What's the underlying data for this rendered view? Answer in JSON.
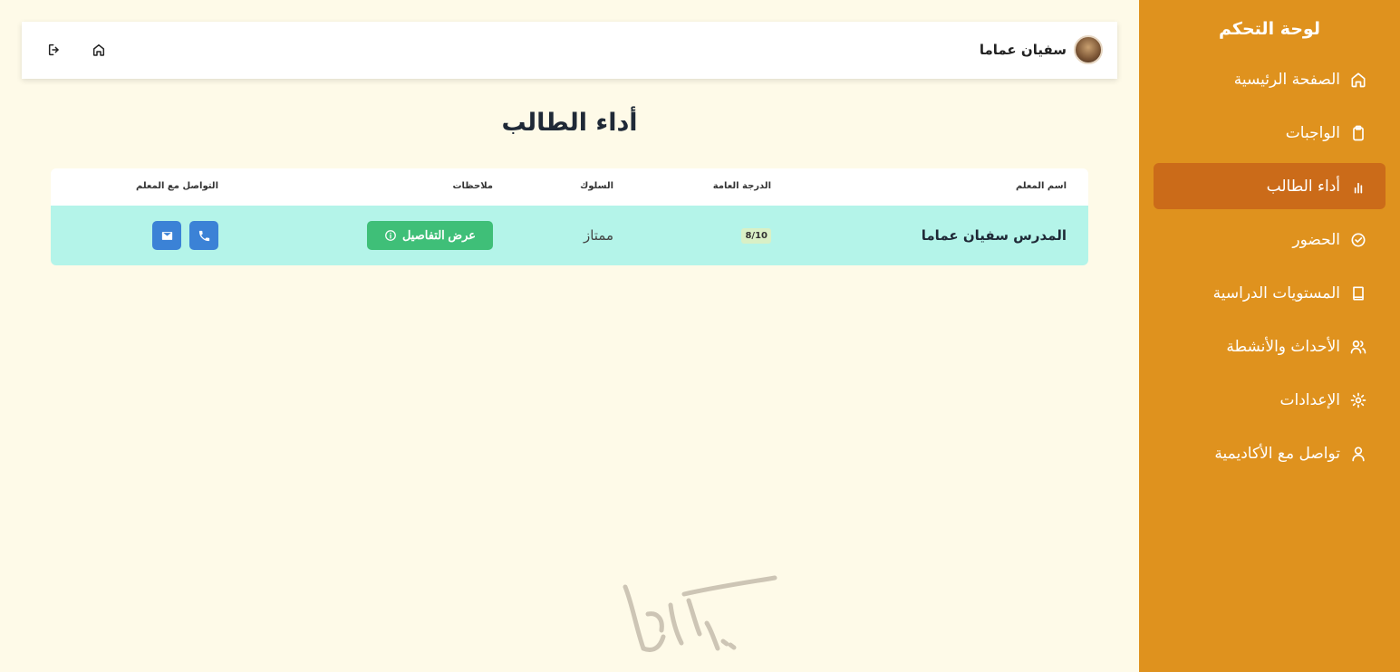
{
  "sidebar": {
    "title": "لوحة التحكم",
    "items": [
      {
        "label": "الصفحة الرئيسية",
        "icon": "home-icon"
      },
      {
        "label": "الواجبات",
        "icon": "clipboard-icon"
      },
      {
        "label": "أداء الطالب",
        "icon": "bar-chart-icon",
        "active": true
      },
      {
        "label": "الحضور",
        "icon": "check-circle-icon"
      },
      {
        "label": "المستويات الدراسية",
        "icon": "book-icon"
      },
      {
        "label": "الأحداث والأنشطة",
        "icon": "users-icon"
      },
      {
        "label": "الإعدادات",
        "icon": "gear-icon"
      },
      {
        "label": "تواصل مع الأكاديمية",
        "icon": "user-icon"
      }
    ]
  },
  "header": {
    "user_name": "سفيان عماما"
  },
  "main": {
    "title": "أداء الطالب",
    "table": {
      "columns": [
        "اسم المعلم",
        "الدرجة العامة",
        "السلوك",
        "ملاحظات",
        "التواصل مع المعلم"
      ],
      "rows": [
        {
          "teacher": "المدرس سفيان عماما",
          "grade": "8/10",
          "behavior": "ممتاز",
          "notes_button": "عرض التفاصيل"
        }
      ]
    }
  },
  "colors": {
    "sidebar_bg": "#df921e",
    "sidebar_active": "#cb6b19",
    "page_bg": "#fefae8",
    "row_bg": "#b4f4e9",
    "details_button": "#3fbf78",
    "contact_button": "#3b82d6"
  }
}
